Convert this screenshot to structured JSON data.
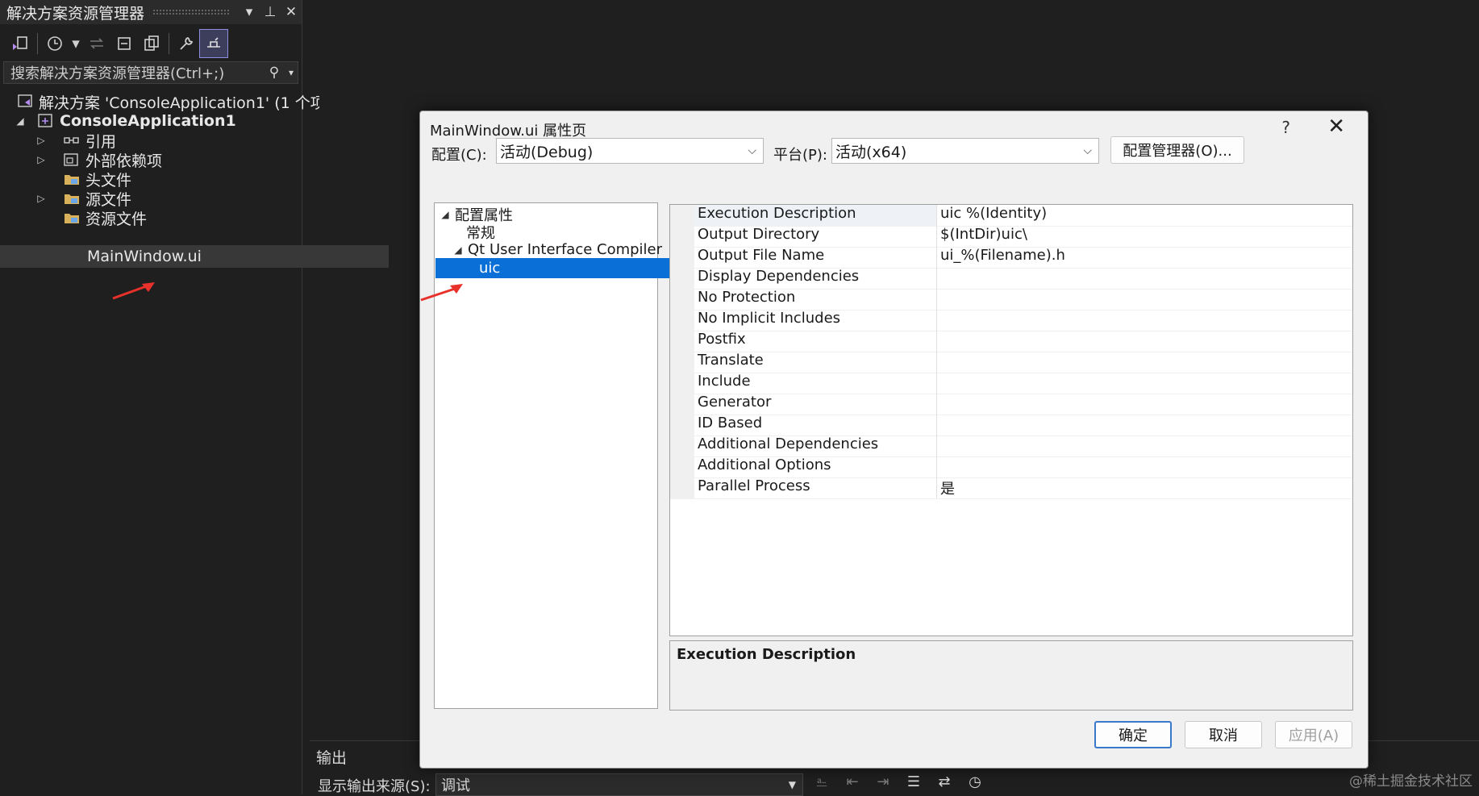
{
  "solution_explorer": {
    "title": "解决方案资源管理器",
    "search_placeholder": "搜索解决方案资源管理器(Ctrl+;)",
    "tree": [
      {
        "label": "解决方案 'ConsoleApplication1' (1 个项",
        "icon": "solution-icon"
      },
      {
        "label": "ConsoleApplication1",
        "icon": "project-icon"
      },
      {
        "label": "引用",
        "icon": "references-icon"
      },
      {
        "label": "外部依赖项",
        "icon": "external-deps-icon"
      },
      {
        "label": "头文件",
        "icon": "folder-icon"
      },
      {
        "label": "源文件",
        "icon": "folder-icon"
      },
      {
        "label": "资源文件",
        "icon": "folder-icon"
      },
      {
        "label": "MainWindow.ui",
        "icon": "none"
      }
    ]
  },
  "output": {
    "title": "输出",
    "source_label": "显示输出来源(S):",
    "source_value": "调试"
  },
  "watermark": "@稀土掘金技术社区",
  "dialog": {
    "title": "MainWindow.ui 属性页",
    "help": "?",
    "config_label": "配置(C):",
    "config_value": "活动(Debug)",
    "platform_label": "平台(P):",
    "platform_value": "活动(x64)",
    "config_manager": "配置管理器(O)...",
    "tree": [
      {
        "label": "配置属性"
      },
      {
        "label": "常规"
      },
      {
        "label": "Qt User Interface Compiler"
      },
      {
        "label": "uic"
      }
    ],
    "properties": [
      {
        "name": "Execution Description",
        "value": "uic %(Identity)"
      },
      {
        "name": "Output Directory",
        "value": "$(IntDir)uic\\"
      },
      {
        "name": "Output File Name",
        "value": "ui_%(Filename).h"
      },
      {
        "name": "Display Dependencies",
        "value": ""
      },
      {
        "name": "No Protection",
        "value": ""
      },
      {
        "name": "No Implicit Includes",
        "value": ""
      },
      {
        "name": "Postfix",
        "value": ""
      },
      {
        "name": "Translate",
        "value": ""
      },
      {
        "name": "Include",
        "value": ""
      },
      {
        "name": "Generator",
        "value": ""
      },
      {
        "name": "ID Based",
        "value": ""
      },
      {
        "name": "Additional Dependencies",
        "value": ""
      },
      {
        "name": "Additional Options",
        "value": ""
      },
      {
        "name": "Parallel Process",
        "value": "是"
      }
    ],
    "description_title": "Execution Description",
    "ok": "确定",
    "cancel": "取消",
    "apply": "应用(A)"
  },
  "colors": {
    "selection": "#0a6fd6",
    "annotation_arrow": "#e8312a"
  }
}
